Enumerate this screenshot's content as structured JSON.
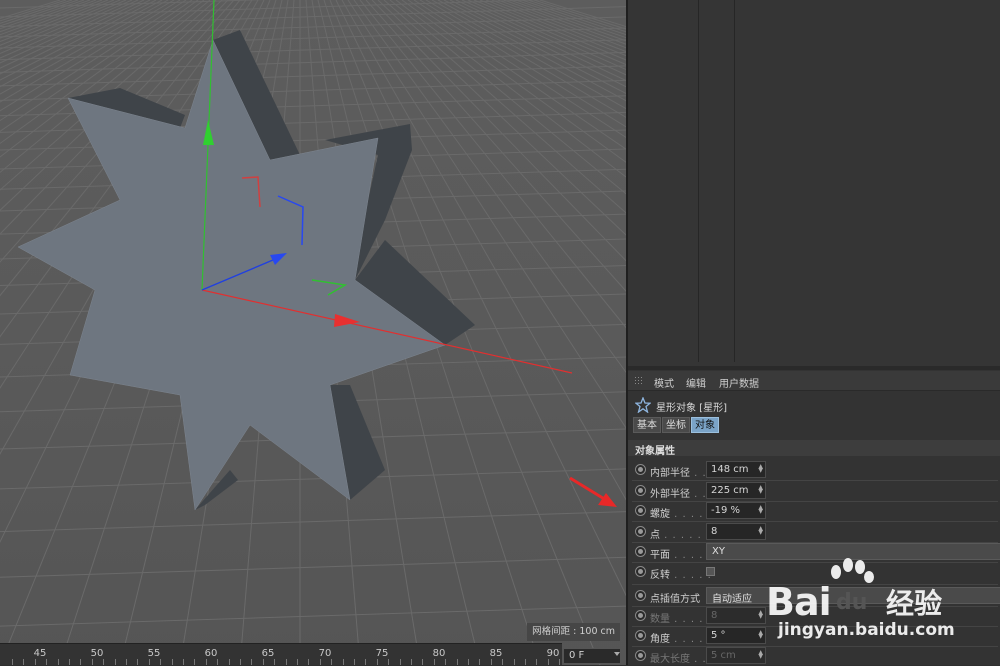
{
  "viewport": {
    "grid_spacing_label": "网格间距 : 100 cm"
  },
  "timeline": {
    "ticks": [
      "45",
      "50",
      "55",
      "60",
      "65",
      "70",
      "75",
      "80",
      "85",
      "90"
    ],
    "current_frame": "0 F"
  },
  "attributes": {
    "menu": {
      "mode": "模式",
      "edit": "编辑",
      "user_data": "用户数据"
    },
    "title": "星形对象 [星形]",
    "tabs": {
      "basic": "基本",
      "coord": "坐标",
      "object": "对象"
    },
    "section": "对象属性",
    "params": {
      "inner_radius": {
        "label": "内部半径",
        "dots": " . .",
        "value": "148 cm"
      },
      "outer_radius": {
        "label": "外部半径",
        "dots": " . .",
        "value": "225 cm"
      },
      "twist": {
        "label": "螺旋",
        "dots": " . . . . .",
        "value": "-19 %"
      },
      "points": {
        "label": "点",
        "dots": " . . . . . . . .",
        "value": "8"
      },
      "plane": {
        "label": "平面",
        "dots": " . . . . .",
        "value": "XY"
      },
      "reverse": {
        "label": "反转",
        "dots": " . . . . ."
      },
      "interp": {
        "label": "点插值方式",
        "value": "自动适应"
      },
      "count": {
        "label": "数量",
        "dots": " . . . . .",
        "value": "8"
      },
      "angle": {
        "label": "角度",
        "dots": " . . . . .",
        "value": "5 °"
      },
      "max_len": {
        "label": "最大长度",
        "dots": " . .",
        "value": "5 cm"
      }
    }
  },
  "watermark": {
    "brand_bai": "Bai",
    "brand_du": "du",
    "brand_jingyan": "经验",
    "url": "jingyan.baidu.com"
  },
  "colors": {
    "viewport_bg": "#5a5a5a",
    "star_face": "#6e7680",
    "star_side": "#3f4449",
    "axis_x": "#e03030",
    "axis_y": "#30c030",
    "axis_z": "#2040e0",
    "tab_active": "#7aa3c7",
    "arrow": "#e82828"
  }
}
